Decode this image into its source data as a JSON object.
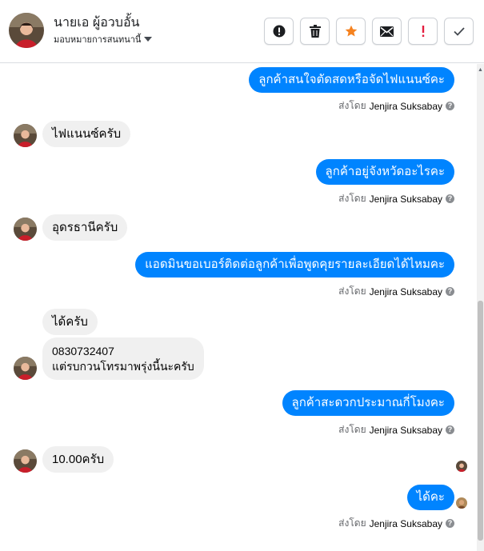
{
  "header": {
    "name": "นายเอ ผู้อวบอั้น",
    "assign_label": "มอบหมายการสนทนานี้",
    "toolbar": [
      "info",
      "trash",
      "star",
      "mail",
      "alert",
      "check"
    ]
  },
  "messages": [
    {
      "type": "out",
      "text": "ลูกค้าสนใจตัดสดหรือจัดไฟแนนซ์คะ",
      "sent_by": "ส่งโดย",
      "agent": "Jenjira Suksabay"
    },
    {
      "type": "in",
      "text": "ไฟแนนซ์ครับ"
    },
    {
      "type": "out",
      "text": "ลูกค้าอยู่จังหวัดอะไรคะ",
      "sent_by": "ส่งโดย",
      "agent": "Jenjira Suksabay"
    },
    {
      "type": "in",
      "text": "อุดรธานีครับ"
    },
    {
      "type": "out",
      "text": "แอดมินขอเบอร์ติดต่อลูกค้าเพื่อพูดคุยรายละเอียดได้ไหมคะ",
      "sent_by": "ส่งโดย",
      "agent": "Jenjira Suksabay"
    },
    {
      "type": "in",
      "text": "ได้ครับ"
    },
    {
      "type": "in",
      "lines": [
        "0830732407",
        "แต่รบกวนโทรมาพรุ่งนี้นะครับ"
      ]
    },
    {
      "type": "out",
      "text": "ลูกค้าสะดวกประมาณกี่โมงคะ",
      "sent_by": "ส่งโดย",
      "agent": "Jenjira Suksabay"
    },
    {
      "type": "in",
      "text": "10.00ครับ"
    },
    {
      "type": "out",
      "text": "ได้คะ",
      "sent_by": "ส่งโดย",
      "agent": "Jenjira Suksabay"
    }
  ],
  "colors": {
    "accent": "#0084ff",
    "incoming": "#f0f0f0",
    "star": "#f5821f",
    "alert": "#e41e3f"
  }
}
